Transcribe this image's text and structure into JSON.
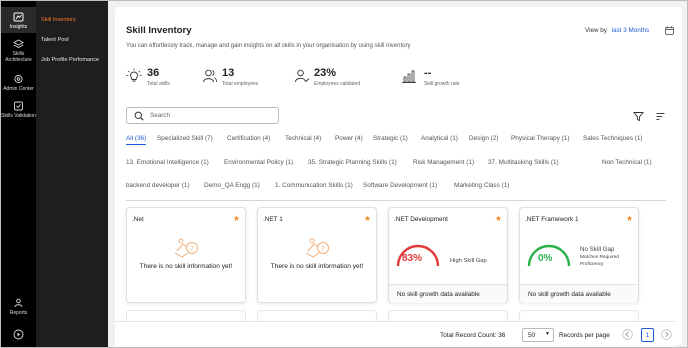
{
  "rail": [
    {
      "label": "Insights",
      "icon": "insights-icon"
    },
    {
      "label": "Skills Architecture",
      "icon": "layers-icon"
    },
    {
      "label": "Admin Center",
      "icon": "gear-icon"
    },
    {
      "label": "Skills Validation",
      "icon": "checkbox-icon"
    },
    {
      "label": "Reports",
      "icon": "reports-icon"
    }
  ],
  "subnav": [
    "Skill Inventory",
    "Talent Pool",
    "Job Profile Perfomance"
  ],
  "header": {
    "title": "Skill Inventory",
    "subtitle": "You can effortlessly track, manage and gain insights on all skills in your organisation by using skill inventory",
    "view_by_label": "View by",
    "view_by_value": "last 3 Months"
  },
  "stats": [
    {
      "value": "36",
      "label": "Total skills",
      "icon": "lightbulb-icon"
    },
    {
      "value": "13",
      "label": "Total employees",
      "icon": "users-icon"
    },
    {
      "value": "23%",
      "label": "Employees validated",
      "icon": "validated-user-icon"
    },
    {
      "value": "--",
      "label": "Skill growth rate",
      "icon": "bar-chart-icon"
    }
  ],
  "search": {
    "placeholder": "Search"
  },
  "filters": [
    [
      "All (36)",
      "Specialized Skill (7)",
      "Certification (4)",
      "Technical (4)",
      "Power (4)",
      "Strategic (1)",
      "Analytical (1)",
      "Design (2)",
      "Physical Therapy (1)",
      "Sales Techniques (1)"
    ],
    [
      "13. Emotional Intelligence (1)",
      "Environmental Policy (1)",
      "35. Strategic Planning Skills (1)",
      "Risk Management (1)",
      "37. Multitasking Skills (1)",
      "Non Technical (1)"
    ],
    [
      "backend developer (1)",
      "Demo_QA Engg (1)",
      "1. Communication Skills (1)",
      "Software Development (1)",
      "Marketing Class (1)"
    ]
  ],
  "cards": [
    {
      "name": ".Net",
      "empty_text": "There is no skill information yet!"
    },
    {
      "name": ".NET 1",
      "empty_text": "There is no skill information yet!"
    },
    {
      "name": ".NET Development",
      "gauge_value": "83%",
      "gauge_label": "High Skill Gap",
      "gauge_color": "#e03a3a",
      "foot": "No skill growth data available"
    },
    {
      "name": ".NET Framework 1",
      "gauge_value": "0%",
      "gauge_label": "No Skill Gap",
      "gauge_sub": "Matches Required Proficiency",
      "gauge_color": "#2bb24c",
      "foot": "No skill growth data available"
    }
  ],
  "footer": {
    "total_label": "Total Record Count: 36",
    "page_size": "50",
    "per_page_label": "Records per page",
    "page": "1"
  }
}
